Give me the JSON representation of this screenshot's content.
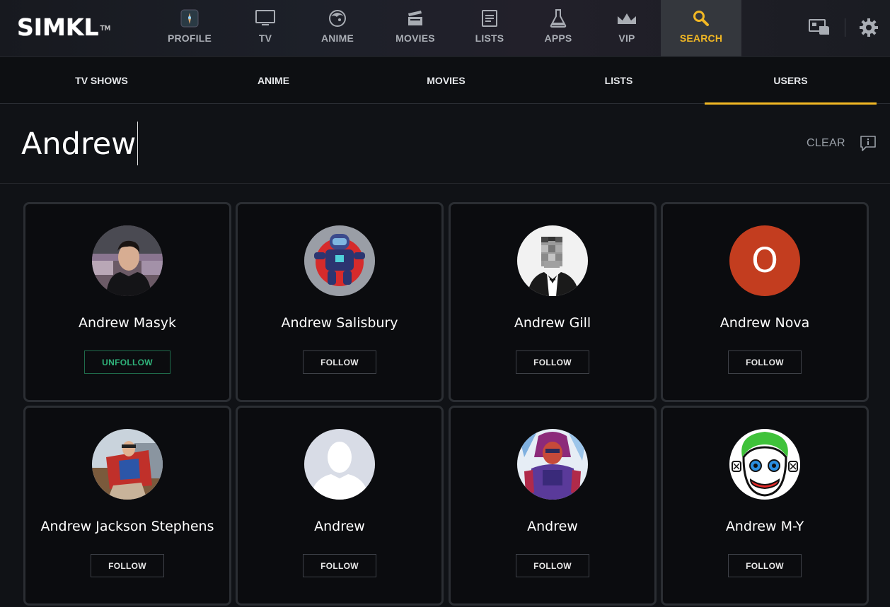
{
  "app": {
    "logo_text": "SIMKL",
    "logo_tm": "TM"
  },
  "nav": {
    "items": [
      {
        "key": "profile",
        "label": "PROFILE",
        "icon": "profile-avatar-icon"
      },
      {
        "key": "tv",
        "label": "TV",
        "icon": "tv-icon"
      },
      {
        "key": "anime",
        "label": "ANIME",
        "icon": "anime-face-icon"
      },
      {
        "key": "movies",
        "label": "MOVIES",
        "icon": "clapperboard-icon"
      },
      {
        "key": "lists",
        "label": "LISTS",
        "icon": "list-document-icon"
      },
      {
        "key": "apps",
        "label": "APPS",
        "icon": "flask-icon"
      },
      {
        "key": "vip",
        "label": "VIP",
        "icon": "crown-icon"
      },
      {
        "key": "search",
        "label": "SEARCH",
        "icon": "search-icon",
        "active": true
      }
    ],
    "right_icons": [
      "watching-cards-icon",
      "gear-icon"
    ]
  },
  "subtabs": {
    "items": [
      {
        "label": "TV SHOWS"
      },
      {
        "label": "ANIME"
      },
      {
        "label": "MOVIES"
      },
      {
        "label": "LISTS"
      },
      {
        "label": "USERS",
        "active": true
      }
    ]
  },
  "search": {
    "value": "Andrew",
    "clear_label": "CLEAR",
    "feedback_icon": "feedback-info-icon"
  },
  "results": [
    {
      "name": "Andrew Masyk",
      "button": "UNFOLLOW",
      "following": true,
      "avatar": "photo-man-dark-shirt"
    },
    {
      "name": "Andrew Salisbury",
      "button": "FOLLOW",
      "following": false,
      "avatar": "robot-illustration"
    },
    {
      "name": "Andrew Gill",
      "button": "FOLLOW",
      "following": false,
      "avatar": "pixelated-man-tuxedo"
    },
    {
      "name": "Andrew Nova",
      "button": "FOLLOW",
      "following": false,
      "avatar": "letter-initial",
      "initial": "O",
      "avatar_color": "#c33d1f"
    },
    {
      "name": "Andrew Jackson Stephens",
      "button": "FOLLOW",
      "following": false,
      "avatar": "photo-man-boat"
    },
    {
      "name": "Andrew",
      "button": "FOLLOW",
      "following": false,
      "avatar": "default-silhouette"
    },
    {
      "name": "Andrew",
      "button": "FOLLOW",
      "following": false,
      "avatar": "comic-hero"
    },
    {
      "name": "Andrew M-Y",
      "button": "FOLLOW",
      "following": false,
      "avatar": "clown-face"
    }
  ],
  "colors": {
    "accent": "#f2b824",
    "unfollow": "#2fb37b",
    "background": "#101216"
  }
}
